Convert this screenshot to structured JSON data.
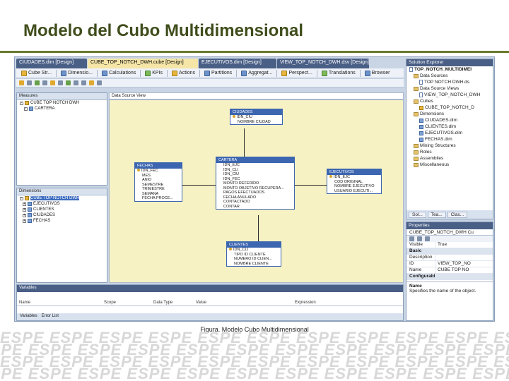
{
  "slide": {
    "title": "Modelo del Cubo Multidimensional",
    "caption": "Figura. Modelo Cubo Multidimensional",
    "watermark_text": "ESPE"
  },
  "doc_tabs": [
    "CIUDADES.dim [Design]",
    "CUBE_TOP_NOTCH_DWH.cube [Design]",
    "EJECUTIVOS.dim [Design]",
    "VIEW_TOP_NOTCH_DWH.dsv [Design]"
  ],
  "designer_tabs": [
    "Cube Str...",
    "Dimensio...",
    "Calculations",
    "KPIs",
    "Actions",
    "Partitions",
    "Aggregat...",
    "Perspect...",
    "Translations",
    "Browser"
  ],
  "measures_pane": {
    "header": "Measures",
    "items": [
      "CUBE TOP NOTCH DWH",
      "CARTERA"
    ]
  },
  "dimensions_pane": {
    "header": "Dimensions",
    "items": [
      "CUBE TOP NOTCH DWH",
      "EJECUTIVOS",
      "CLIENTES",
      "CIUDADES",
      "FECHAS"
    ]
  },
  "dsv": {
    "header": "Data Source View",
    "tables": {
      "ciudades": {
        "name": "CIUDADES",
        "key": "IDN_CIU",
        "cols": [
          "NOMBRE CIUDAD"
        ]
      },
      "fechas": {
        "name": "FECHAS",
        "key": "IDN_FEC",
        "cols": [
          "MES",
          "ANIO",
          "SEMESTRE",
          "TRIMESTRE",
          "SEMANA",
          "FECHA PROCE..."
        ]
      },
      "cartera": {
        "name": "CARTERA",
        "key": "",
        "cols": [
          "IDN_EJC",
          "IDN_CLI",
          "IDN_CIU",
          "IDN_FEC",
          "MONTO REFERIDO",
          "MONTO OBJETIVO RECUPERA...",
          "PAGOS EFECTUADOS",
          "FECHA ANULADO",
          "CONTACTADO",
          "CONTAR"
        ]
      },
      "ejecutivos": {
        "name": "EJECUTIVOS",
        "key": "IDN_EJC",
        "cols": [
          "COD ORIGINAL",
          "NOMBRE EJECUTIVO",
          "USUARIO EJECUTI..."
        ]
      },
      "clientes": {
        "name": "CLIENTES",
        "key": "IDN_CLI",
        "cols": [
          "TIPO ID CLIENTE",
          "NUMERO ID CLIEN...",
          "NOMBRE CLIENTE"
        ]
      }
    }
  },
  "variables_pane": {
    "header": "Variables",
    "columns": [
      "Name",
      "Scope",
      "Data Type",
      "Value",
      "Expression"
    ],
    "tabs": [
      "Variables",
      "Error List"
    ]
  },
  "solution_explorer": {
    "header": "Solution Explorer",
    "items": [
      "TOP_NOTCH_MULTIDIMEI",
      "Data Sources",
      "TOP NOTCH DWH.ds",
      "Data Source Views",
      "VIEW_TOP_NOTCH_DWH",
      "Cubes",
      "CUBE_TOP_NOTCH_D",
      "Dimensions",
      "CIUDADES.dim",
      "CLIENTES.dim",
      "EJECUTIVOS.dim",
      "FECHAS.dim",
      "Mining Structures",
      "Roles",
      "Assemblies",
      "Miscellaneous"
    ],
    "tabs": [
      "Sol...",
      "Tea...",
      "Clas..."
    ]
  },
  "properties": {
    "header": "Properties",
    "object": "CUBE_TOP_NOTCH_DWH Cu",
    "rows": [
      {
        "k": "Visible",
        "v": "True"
      },
      {
        "k": "Basic",
        "v": "",
        "cat": true
      },
      {
        "k": "Description",
        "v": ""
      },
      {
        "k": "ID",
        "v": "VIEW_TOP_NO"
      },
      {
        "k": "Name",
        "v": "CUBE TOP NO"
      },
      {
        "k": "Configurable",
        "v": "",
        "cat": true
      }
    ],
    "help_title": "Name",
    "help_text": "Specifies the name of the object."
  }
}
